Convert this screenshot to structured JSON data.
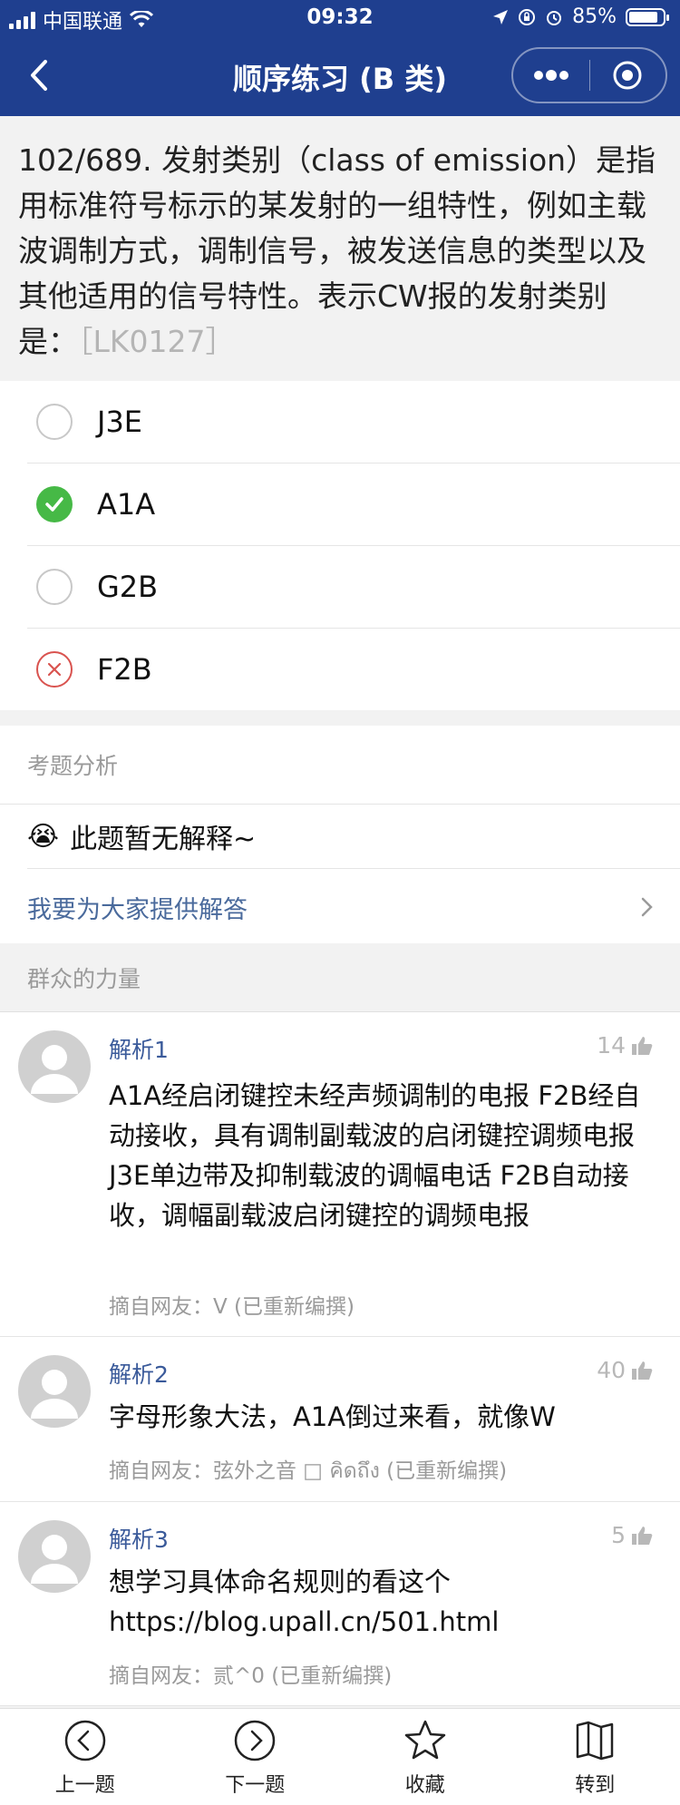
{
  "status_bar": {
    "carrier": "中国联通",
    "time": "09:32",
    "battery": "85%",
    "battery_level": 0.85
  },
  "nav": {
    "title": "顺序练习 (B 类)",
    "back_icon": "chevron-left-icon",
    "more_icon": "more-dots-icon",
    "close_icon": "target-circle-icon"
  },
  "question": {
    "text": "102/689. 发射类别（class of emission）是指用标准符号标示的某发射的一组特性，例如主载波调制方式，调制信号，被发送信息的类型以及其他适用的信号特性。表示CW报的发射类别是：",
    "code": "［LK0127］"
  },
  "options": [
    {
      "label": "J3E",
      "state": "unselected"
    },
    {
      "label": "A1A",
      "state": "correct"
    },
    {
      "label": "G2B",
      "state": "unselected"
    },
    {
      "label": "F2B",
      "state": "wrong"
    }
  ],
  "analysis": {
    "header": "考题分析",
    "emoji": "😭",
    "no_explanation": "此题暂无解释~",
    "provide_link": "我要为大家提供解答"
  },
  "crowd": {
    "header": "群众的力量",
    "comments": [
      {
        "title": "解析1",
        "likes": "14",
        "text": "A1A经启闭键控未经声频调制的电报 F2B经自动接收，具有调制副载波的启闭键控调频电报 J3E单边带及抑制载波的调幅电话 F2B自动接收，调幅副载波启闭键控的调频电报",
        "from": "摘自网友：V (已重新编撰)"
      },
      {
        "title": "解析2",
        "likes": "40",
        "text": "字母形象大法，A1A倒过来看，就像W",
        "from": "摘自网友：弦外之音 □ คิดถึง (已重新编撰)"
      },
      {
        "title": "解析3",
        "likes": "5",
        "text": "想学习具体命名规则的看这个 https://blog.upall.cn/501.html",
        "from": "摘自网友：贰^0 (已重新编撰)"
      }
    ]
  },
  "tabbar": [
    {
      "label": "上一题",
      "icon": "prev-circle-icon"
    },
    {
      "label": "下一题",
      "icon": "next-circle-icon"
    },
    {
      "label": "收藏",
      "icon": "star-icon"
    },
    {
      "label": "转到",
      "icon": "book-icon"
    }
  ],
  "colors": {
    "nav_bg": "#1f3f8f",
    "correct": "#46b946",
    "wrong": "#d9534f",
    "link": "#3a5a9a"
  }
}
